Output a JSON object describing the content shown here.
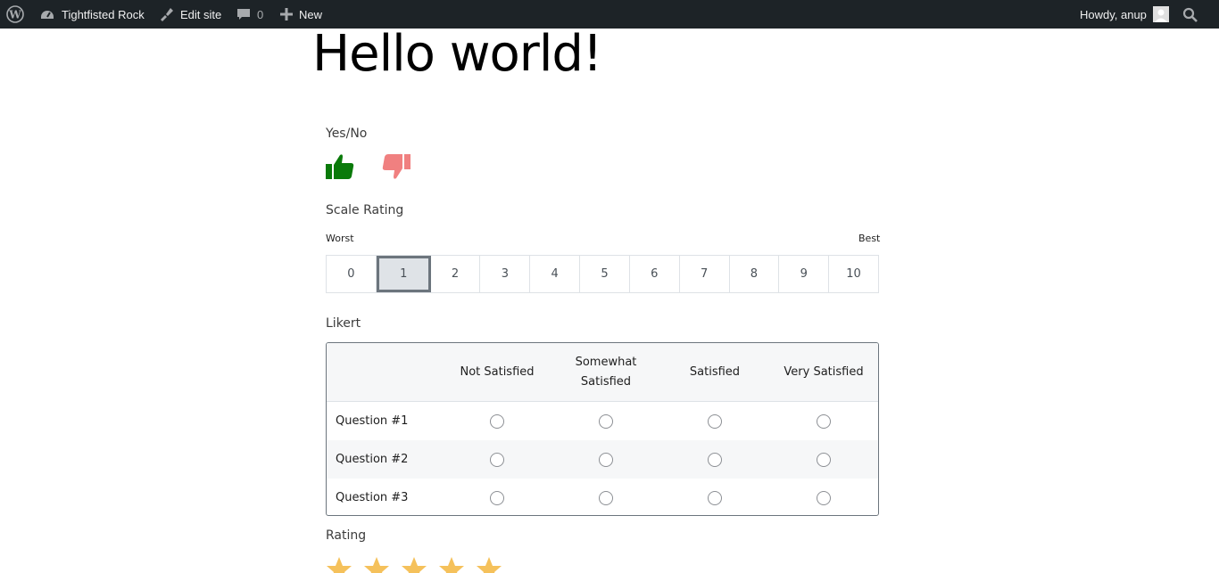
{
  "adminbar": {
    "site_name": "Tightfisted Rock",
    "edit_site": "Edit site",
    "comments_count": "0",
    "new_label": "New",
    "howdy": "Howdy, anup"
  },
  "page": {
    "title": "Hello world!"
  },
  "yesno": {
    "label": "Yes/No",
    "colors": {
      "yes": "#0a7a0a",
      "no": "#f08080"
    }
  },
  "scale": {
    "label": "Scale Rating",
    "worst": "Worst",
    "best": "Best",
    "options": [
      "0",
      "1",
      "2",
      "3",
      "4",
      "5",
      "6",
      "7",
      "8",
      "9",
      "10"
    ],
    "selected": "1"
  },
  "likert": {
    "label": "Likert",
    "columns": [
      "Not Satisfied",
      "Somewhat Satisfied",
      "Satisfied",
      "Very Satisfied"
    ],
    "questions": [
      "Question #1",
      "Question #2",
      "Question #3"
    ]
  },
  "rating": {
    "label": "Rating",
    "star_count": 5,
    "star_color": "#f5c15b"
  }
}
